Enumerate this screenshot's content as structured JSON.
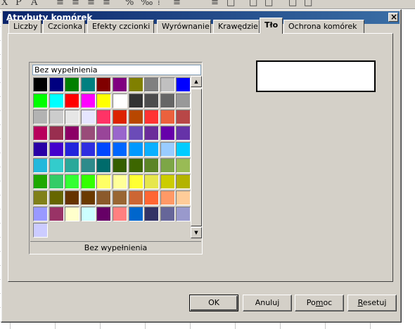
{
  "dialog": {
    "title": "Atrybuty komórek",
    "close_glyph": "×"
  },
  "tabs": [
    {
      "label": "Liczby",
      "active": false
    },
    {
      "label": "Czcionka",
      "active": false
    },
    {
      "label": "Efekty czcionki",
      "active": false
    },
    {
      "label": "Wyrównanie",
      "active": false
    },
    {
      "label": "Krawędzie",
      "active": false
    },
    {
      "label": "Tło",
      "active": true
    },
    {
      "label": "Ochrona komórek",
      "active": false
    }
  ],
  "background_tab": {
    "selected_color_name": "Bez wypełnienia",
    "footer_label": "Bez wypełnienia",
    "preview_color": "#ffffff",
    "palette": [
      [
        "#000000",
        "#000080",
        "#008000",
        "#008080",
        "#800000",
        "#800080",
        "#808000",
        "#808080",
        "#c0c0c0",
        "#0000ff"
      ],
      [
        "#00ff00",
        "#00ffff",
        "#ff0000",
        "#ff00ff",
        "#ffff00",
        "#ffffff",
        "#333333",
        "#4d4d4d",
        "#666666",
        "#999999"
      ],
      [
        "#b3b3b3",
        "#cccccc",
        "#e6e6e6",
        "#e6e6ff",
        "#ff3366",
        "#dc2300",
        "#b84700",
        "#ff3333",
        "#eb613d",
        "#b84747"
      ],
      [
        "#b8005c",
        "#992e4f",
        "#8c0066",
        "#994c79",
        "#994599",
        "#9966cc",
        "#6b4bb8",
        "#6b2c9a",
        "#6600aa",
        "#6633a8"
      ],
      [
        "#2a00a5",
        "#4400cc",
        "#2323dc",
        "#2e2ee0",
        "#0047ff",
        "#0066ff",
        "#0099ff",
        "#0ab0ff",
        "#99ccff",
        "#00ccff"
      ],
      [
        "#23b8dc",
        "#33cccc",
        "#2aa89a",
        "#2e8b8b",
        "#006b6b",
        "#355e00",
        "#3d6600",
        "#5c8526",
        "#7da647",
        "#99bb55"
      ],
      [
        "#1ea800",
        "#33cc66",
        "#33ff33",
        "#33ff00",
        "#ffff66",
        "#ffff99",
        "#ffff33",
        "#e6e64c",
        "#cccc00",
        "#b3b300"
      ],
      [
        "#808019",
        "#666600",
        "#663300",
        "#6b3a00",
        "#8b5a2b",
        "#996633",
        "#cc6633",
        "#ff6633",
        "#ff9966",
        "#ffcc99"
      ],
      [
        "#9999ff",
        "#993366",
        "#ffffcc",
        "#ccffff",
        "#660066",
        "#ff8080",
        "#0066cc",
        "#333366",
        "#666699",
        "#9999cc"
      ],
      [
        "#ccccff"
      ]
    ]
  },
  "scrollbar": {
    "up_glyph": "▲",
    "down_glyph": "▼"
  },
  "buttons": {
    "ok": "OK",
    "cancel": "Anuluj",
    "help_prefix": "Po",
    "help_accel": "m",
    "help_suffix": "oc",
    "reset_accel": "R",
    "reset_suffix": "esetuj"
  },
  "toolbar_glyphs": [
    "X",
    "P",
    "A",
    "≡",
    "≡",
    "≡",
    "≡",
    "%",
    "‰",
    "⁞",
    "≡",
    "≡",
    "□",
    "□",
    "□",
    "□",
    "□"
  ]
}
